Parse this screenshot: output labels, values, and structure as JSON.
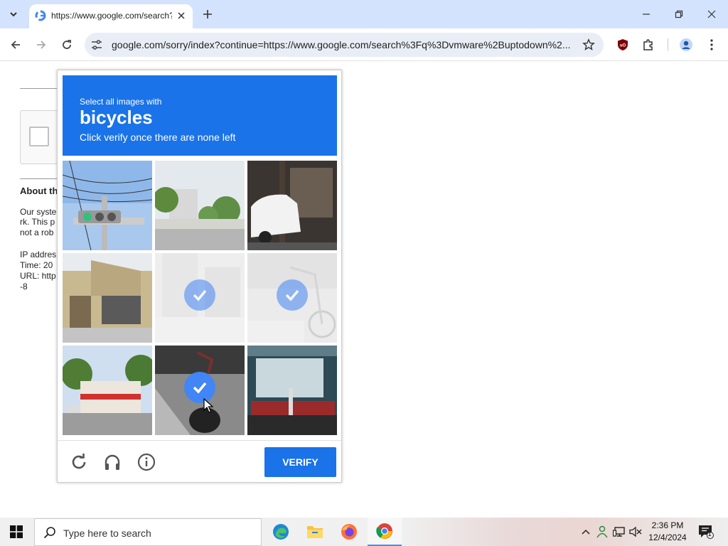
{
  "browser": {
    "tab_title": "https://www.google.com/search?q=vmware+buptodown",
    "url": "google.com/sorry/index?continue=https://www.google.com/search%3Fq%3Dvmware%2Buptodown%2..."
  },
  "background_page": {
    "about_heading": "About th",
    "lines": [
      "Our syste",
      "rk. This p",
      "not a rob",
      "IP addres",
      "Time: 20",
      "URL: http",
      "-8"
    ]
  },
  "captcha": {
    "instruction": "Select all images with",
    "target": "bicycles",
    "subtitle": "Click verify once there are none left",
    "verify_label": "VERIFY",
    "tiles": [
      {
        "name": "traffic-light",
        "selected": false
      },
      {
        "name": "street-houses",
        "selected": false
      },
      {
        "name": "white-car-garage",
        "selected": false
      },
      {
        "name": "storefront",
        "selected": false
      },
      {
        "name": "faded-street",
        "selected": true
      },
      {
        "name": "faded-bicycle",
        "selected": true
      },
      {
        "name": "shop-building",
        "selected": false
      },
      {
        "name": "motorbike-road",
        "selected": true
      },
      {
        "name": "signboard",
        "selected": false
      }
    ],
    "colors": {
      "accent": "#1a73e8",
      "check": "#4285f4"
    }
  },
  "taskbar": {
    "search_placeholder": "Type here to search",
    "time": "2:36 PM",
    "date": "12/4/2024",
    "notification_count": "1"
  }
}
